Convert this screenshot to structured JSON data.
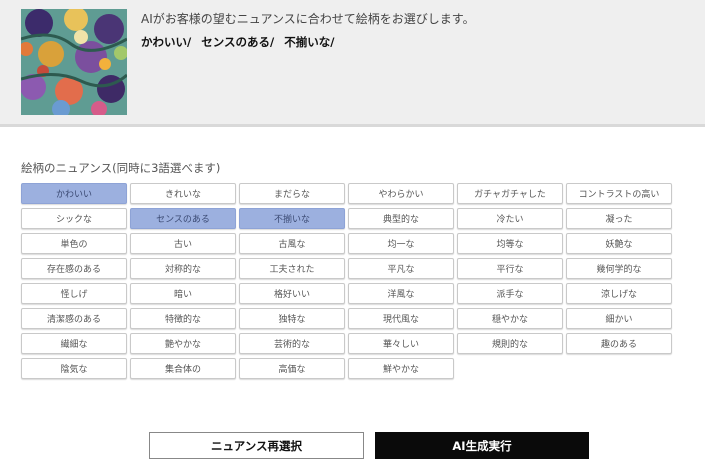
{
  "header": {
    "description": "AIがお客様の望むニュアンスに合わせて絵柄をお選びします。",
    "selected": [
      "かわいい/",
      "センスのある/",
      "不揃いな/"
    ]
  },
  "nuance": {
    "label": "絵柄のニュアンス(同時に3語選べます)",
    "selected_color": "#9cb0df",
    "chips": [
      {
        "label": "かわいい",
        "selected": true
      },
      {
        "label": "きれいな",
        "selected": false
      },
      {
        "label": "まだらな",
        "selected": false
      },
      {
        "label": "やわらかい",
        "selected": false
      },
      {
        "label": "ガチャガチャした",
        "selected": false
      },
      {
        "label": "コントラストの高い",
        "selected": false
      },
      {
        "label": "シックな",
        "selected": false
      },
      {
        "label": "センスのある",
        "selected": true
      },
      {
        "label": "不揃いな",
        "selected": true
      },
      {
        "label": "典型的な",
        "selected": false
      },
      {
        "label": "冷たい",
        "selected": false
      },
      {
        "label": "凝った",
        "selected": false
      },
      {
        "label": "単色の",
        "selected": false
      },
      {
        "label": "古い",
        "selected": false
      },
      {
        "label": "古風な",
        "selected": false
      },
      {
        "label": "均一な",
        "selected": false
      },
      {
        "label": "均等な",
        "selected": false
      },
      {
        "label": "妖艶な",
        "selected": false
      },
      {
        "label": "存在感のある",
        "selected": false
      },
      {
        "label": "対称的な",
        "selected": false
      },
      {
        "label": "工夫された",
        "selected": false
      },
      {
        "label": "平凡な",
        "selected": false
      },
      {
        "label": "平行な",
        "selected": false
      },
      {
        "label": "幾何学的な",
        "selected": false
      },
      {
        "label": "怪しげ",
        "selected": false
      },
      {
        "label": "暗い",
        "selected": false
      },
      {
        "label": "格好いい",
        "selected": false
      },
      {
        "label": "洋風な",
        "selected": false
      },
      {
        "label": "派手な",
        "selected": false
      },
      {
        "label": "涼しげな",
        "selected": false
      },
      {
        "label": "清潔感のある",
        "selected": false
      },
      {
        "label": "特徴的な",
        "selected": false
      },
      {
        "label": "独特な",
        "selected": false
      },
      {
        "label": "現代風な",
        "selected": false
      },
      {
        "label": "穏やかな",
        "selected": false
      },
      {
        "label": "細かい",
        "selected": false
      },
      {
        "label": "繊細な",
        "selected": false
      },
      {
        "label": "艶やかな",
        "selected": false
      },
      {
        "label": "芸術的な",
        "selected": false
      },
      {
        "label": "華々しい",
        "selected": false
      },
      {
        "label": "規則的な",
        "selected": false
      },
      {
        "label": "趣のある",
        "selected": false
      },
      {
        "label": "陰気な",
        "selected": false
      },
      {
        "label": "集合体の",
        "selected": false
      },
      {
        "label": "高価な",
        "selected": false
      },
      {
        "label": "鮮やかな",
        "selected": false
      }
    ]
  },
  "actions": {
    "reselect_label": "ニュアンス再選択",
    "generate_label": "AI生成実行"
  }
}
